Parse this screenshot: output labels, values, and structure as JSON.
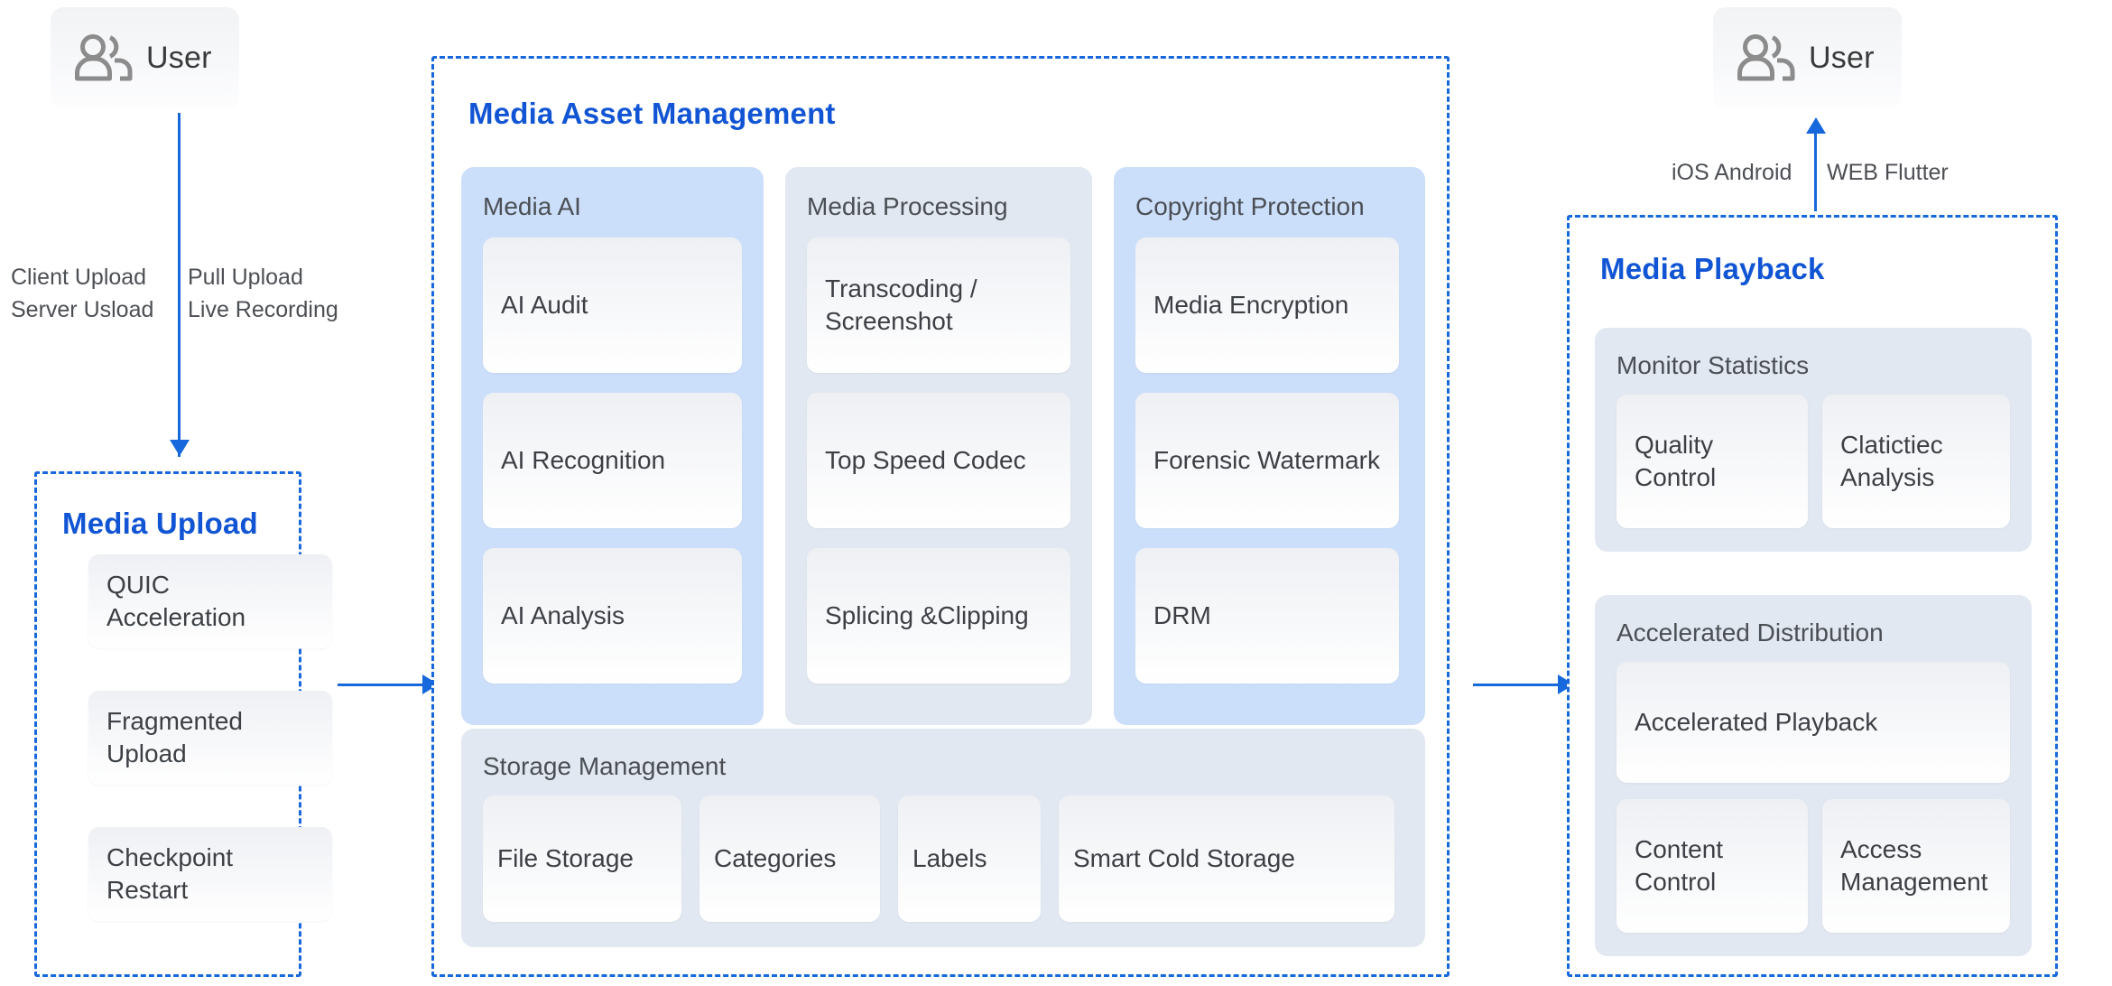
{
  "diagram": {
    "accent_blue": "#1155d4",
    "line_blue": "#1668dc",
    "group_gray": "#e2e8f1",
    "group_blue": "#ccdffa",
    "card_text": "#3c3f44"
  },
  "left_user": {
    "label": "User",
    "icon": "users-icon"
  },
  "right_user": {
    "label": "User",
    "icon": "users-icon"
  },
  "upload_methods": {
    "left_line1": "Client Upload",
    "left_line2": "Server Usload",
    "right_line1": "Pull Upload",
    "right_line2": "Live Recording"
  },
  "playback_clients": {
    "left": "iOS Android",
    "right": "WEB Flutter"
  },
  "media_upload": {
    "title": "Media Upload",
    "cards": [
      "QUIC Acceleration",
      "Fragmented Upload",
      "Checkpoint Restart"
    ]
  },
  "media_asset_management": {
    "title": "Media Asset Management",
    "columns": [
      {
        "title": "Media AI",
        "highlight": true,
        "cards": [
          "AI Audit",
          "AI Recognition",
          "AI Analysis"
        ]
      },
      {
        "title": "Media Processing",
        "highlight": false,
        "cards": [
          "Transcoding / Screenshot",
          "Top Speed Codec",
          "Splicing &Clipping"
        ]
      },
      {
        "title": "Copyright Protection",
        "highlight": true,
        "cards": [
          "Media Encryption",
          "Forensic Watermark",
          "DRM"
        ]
      }
    ],
    "storage": {
      "title": "Storage Management",
      "cards": [
        "File Storage",
        "Categories",
        "Labels",
        "Smart Cold Storage"
      ]
    }
  },
  "media_playback": {
    "title": "Media Playback",
    "groups": [
      {
        "title": "Monitor Statistics",
        "cards": [
          "Quality Control",
          "Clatictiec Analysis"
        ]
      },
      {
        "title": "Accelerated Distribution",
        "cards": [
          "Accelerated Playback",
          "Content Control",
          "Access Management"
        ]
      }
    ]
  }
}
